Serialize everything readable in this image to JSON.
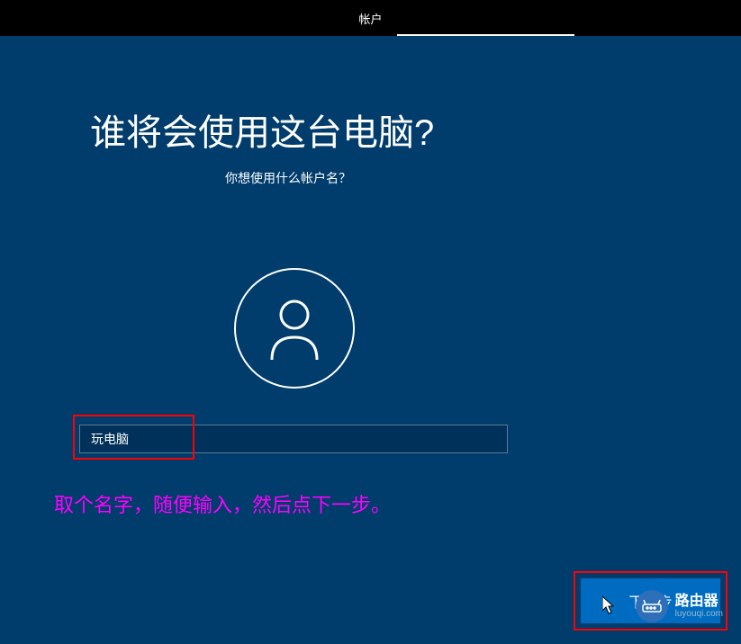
{
  "topBar": {
    "label": "帐户"
  },
  "title": "谁将会使用这台电脑?",
  "subtitle": "你想使用什么帐户名？",
  "usernameInput": {
    "value": "玩电脑",
    "placeholder": ""
  },
  "annotation": "取个名字，随便输入，然后点下一步。",
  "nextButton": {
    "label": "下一步"
  },
  "watermark": {
    "title": "路由器",
    "url": "luyouqi.com"
  }
}
